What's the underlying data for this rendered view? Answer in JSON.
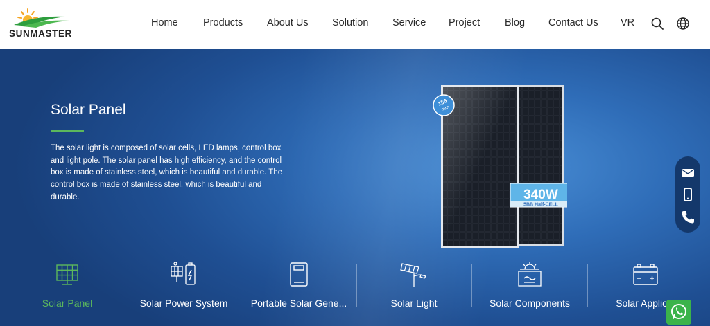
{
  "brand": {
    "name": "SUNMASTER"
  },
  "nav": {
    "items": [
      "Home",
      "Products",
      "About Us",
      "Solution",
      "Service",
      "Project",
      "Blog",
      "Contact Us",
      "VR"
    ],
    "icons": [
      "search-icon",
      "globe-icon"
    ]
  },
  "hero": {
    "title": "Solar Panel",
    "description": "The solar light is composed of solar cells, LED lamps, control box and light pole. The solar panel has high efficiency, and the control box is made of stainless steel, which is beautiful and durable. The control box is made of stainless steel, which is beautiful and durable.",
    "badge_size": "156",
    "badge_unit": "mm",
    "power_label": "340W",
    "power_sub": "5BB Half-CELL"
  },
  "contact_bar": {
    "icons": [
      "mail-icon",
      "mobile-icon",
      "phone-icon"
    ]
  },
  "categories": [
    {
      "label": "Solar Panel",
      "icon": "solar-panel-icon",
      "active": true
    },
    {
      "label": "Solar Power System",
      "icon": "power-system-icon",
      "active": false
    },
    {
      "label": "Portable Solar Gene...",
      "icon": "portable-generator-icon",
      "active": false
    },
    {
      "label": "Solar Light",
      "icon": "street-light-icon",
      "active": false
    },
    {
      "label": "Solar Components",
      "icon": "components-icon",
      "active": false
    },
    {
      "label": "Solar Applicat",
      "icon": "battery-icon",
      "active": false
    }
  ],
  "colors": {
    "accent_green": "#5cb85c",
    "hero_blue": "#2f6db8",
    "whatsapp_green": "#3bb34a"
  }
}
